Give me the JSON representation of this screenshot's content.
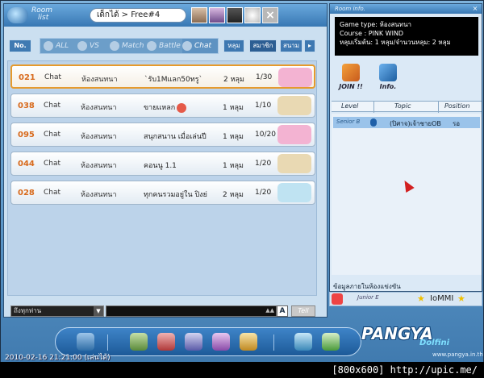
{
  "lobby": {
    "title_line1": "Room",
    "title_line2": "list",
    "breadcrumb": "เด็กได้ > Free#4",
    "filters": [
      {
        "label": "ALL",
        "icon": "refresh-icon"
      },
      {
        "label": "VS",
        "icon": "vs-icon"
      },
      {
        "label": "Match",
        "icon": "match-icon"
      },
      {
        "label": "Battle",
        "icon": "battle-icon"
      },
      {
        "label": "Chat",
        "icon": "chat-icon",
        "active": true
      }
    ],
    "no_label": "No.",
    "sort_hole": "หลุม",
    "sort_member": "สมาชิก",
    "sort_course": "สนาม",
    "next_arrow": "▸"
  },
  "rooms": [
    {
      "num": "021",
      "type": "Chat",
      "mode": "ห้องสนทนา",
      "name": "`รับ1Mแลก50ทรู`",
      "holes": "2 หลุม",
      "count": "1/30",
      "course": "PINK WIND",
      "course_color": "#f3b3d2",
      "selected": true
    },
    {
      "num": "038",
      "type": "Chat",
      "mode": "ห้องสนทนา",
      "name": "ขายแหลก",
      "holes": "1 หลุม",
      "count": "1/10",
      "course": "SEPIA",
      "course_color": "#e9d9b3",
      "emoji": true
    },
    {
      "num": "095",
      "type": "Chat",
      "mode": "ห้องสนทนา",
      "name": "สนุกสนาน เมื่อเล่นปี",
      "holes": "1 หลุม",
      "count": "10/20",
      "course": "WIND",
      "course_color": "#f3b3d2"
    },
    {
      "num": "044",
      "type": "Chat",
      "mode": "ห้องสนทนา",
      "name": "คอนนู 1.1",
      "holes": "1 หลุม",
      "count": "1/20",
      "course": "SEPIA",
      "course_color": "#e9d9b3"
    },
    {
      "num": "028",
      "type": "Chat",
      "mode": "ห้องสนทนา",
      "name": "ทุกคนรวมอยู่ใน ปิงย่",
      "holes": "2 หลุม",
      "count": "1/20",
      "course": "BLUE",
      "course_color": "#bfe3f2"
    }
  ],
  "chat": {
    "channel": "ถึงทุกท่าน",
    "scroll_up": "▲▲",
    "a_button": "A",
    "tell_button": "Tell"
  },
  "room_info": {
    "title": "Room info.",
    "lines": [
      "Game type: ห้องสนทนา",
      "Course : PINK WIND",
      "หลุมเริ่มต้น: 1 หลุม/จำนวนหลุม: 2 หลุม"
    ],
    "join_label": "JOIN !!",
    "info_label": "Info.",
    "columns": {
      "level": "Level",
      "topic": "Topic",
      "position": "Position"
    },
    "players": [
      {
        "level": "Senior B",
        "topic": "(ปิศาจ)เจ้าชายOB",
        "position": "รอ"
      }
    ],
    "footer": "ข้อมูลภายในห้องแข่งขัน"
  },
  "player_bar": {
    "rank": "Junior E",
    "name": "IoMMI"
  },
  "brand": {
    "title": "PANGYA",
    "subtitle": "Dolfini",
    "url": "www.pangya.in.th"
  },
  "timestamp": "2010-02-16 21:21:00 (เล่นได้)",
  "watermark": "[800x600] http://upic.me/"
}
